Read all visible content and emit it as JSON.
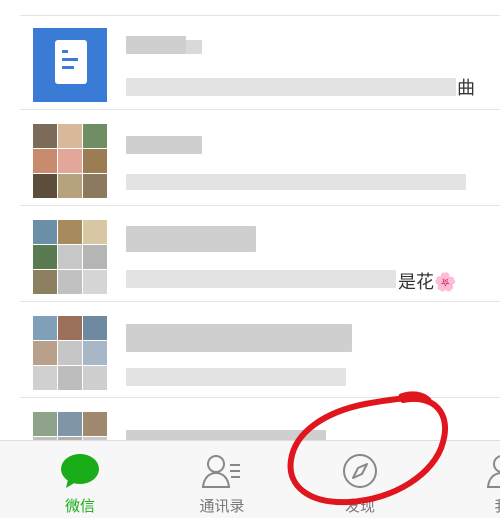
{
  "chats": [
    {
      "preview_suffix": ""
    },
    {
      "preview_suffix": "曲"
    },
    {
      "preview_suffix": ""
    },
    {
      "preview_suffix": "是花🌸"
    },
    {
      "preview_suffix": ""
    },
    {
      "preview_suffix": ""
    }
  ],
  "tabs": [
    {
      "label": "微信",
      "icon": "chat-bubble-icon",
      "active": true
    },
    {
      "label": "通讯录",
      "icon": "contacts-icon",
      "active": false
    },
    {
      "label": "发现",
      "icon": "compass-icon",
      "active": false
    },
    {
      "label": "我",
      "icon": "person-icon",
      "active": false
    }
  ],
  "colors": {
    "active_tab": "#1aad19",
    "inactive_tab": "#777777",
    "annotation": "#e0161e",
    "file_avatar": "#3a7bd5"
  }
}
